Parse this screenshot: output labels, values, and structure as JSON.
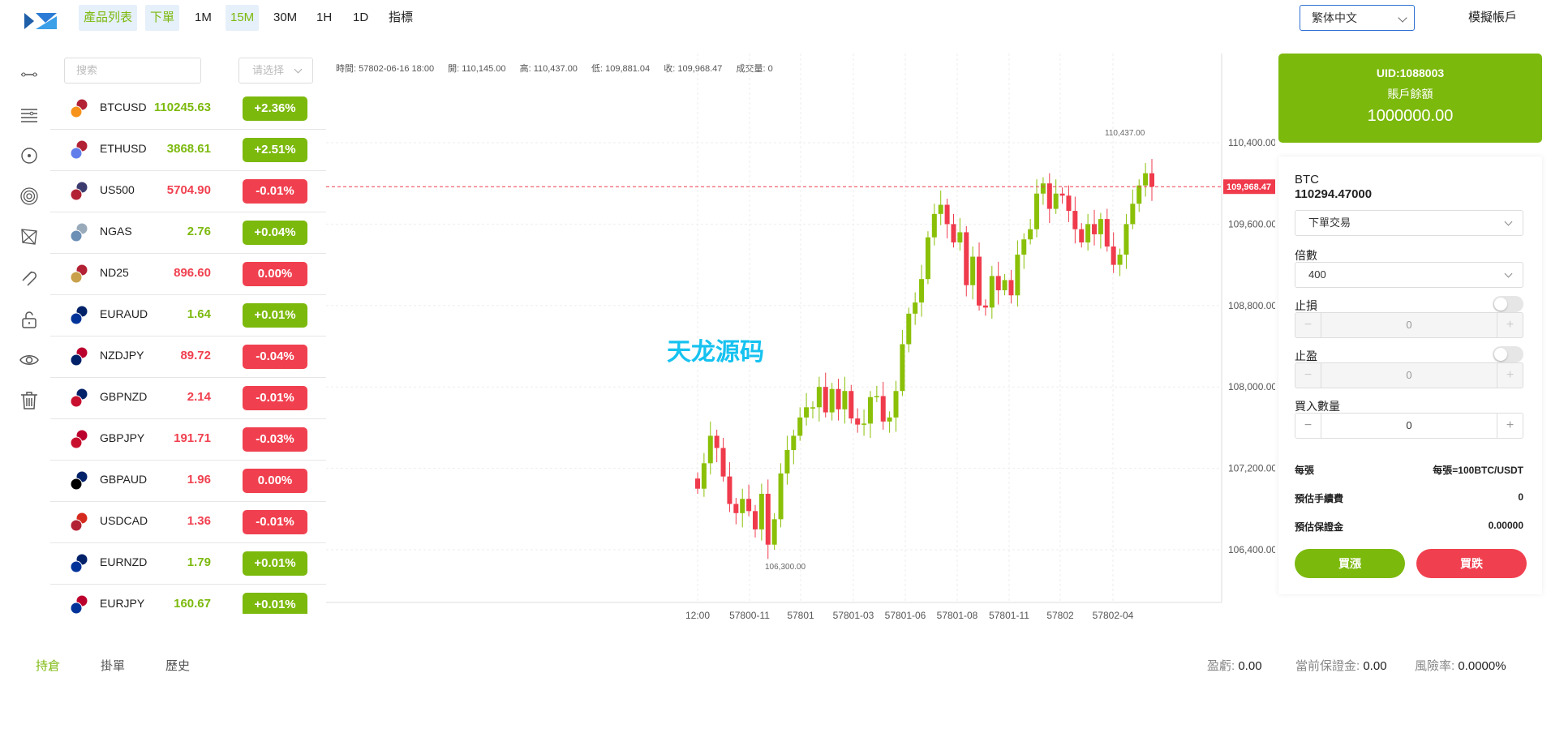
{
  "topbar": {
    "nav": [
      {
        "label": "產品列表",
        "active": true
      },
      {
        "label": "下單",
        "active": true
      },
      {
        "label": "1M",
        "active": false
      },
      {
        "label": "15M",
        "active": true
      },
      {
        "label": "30M",
        "active": false
      },
      {
        "label": "1H",
        "active": false
      },
      {
        "label": "1D",
        "active": false
      },
      {
        "label": "指標",
        "active": false
      }
    ],
    "language": "繁体中文",
    "demo_account": "模擬帳戶"
  },
  "toolbar_icons": [
    "trend-line-icon",
    "horizontal-lines-icon",
    "crosshair-icon",
    "target-icon",
    "pattern-icon",
    "magnet-icon",
    "lock-icon",
    "eye-icon",
    "trash-icon"
  ],
  "product_list": {
    "search_placeholder": "搜索",
    "filter_placeholder": "请选择",
    "items": [
      {
        "symbol": "BTCUSD",
        "price": "110245.63",
        "change": "+2.36%",
        "dir": "up",
        "flag": "btc-usd-flag-icon"
      },
      {
        "symbol": "ETHUSD",
        "price": "3868.61",
        "change": "+2.51%",
        "dir": "up",
        "flag": "eth-usd-flag-icon"
      },
      {
        "symbol": "US500",
        "price": "5704.90",
        "change": "-0.01%",
        "dir": "down",
        "flag": "us500-flag-icon"
      },
      {
        "symbol": "NGAS",
        "price": "2.76",
        "change": "+0.04%",
        "dir": "up",
        "flag": "ngas-logo-icon"
      },
      {
        "symbol": "ND25",
        "price": "896.60",
        "change": "0.00%",
        "dir": "down",
        "flag": "nd25-flag-icon"
      },
      {
        "symbol": "EURAUD",
        "price": "1.64",
        "change": "+0.01%",
        "dir": "up",
        "flag": "eur-aud-flag-icon"
      },
      {
        "symbol": "NZDJPY",
        "price": "89.72",
        "change": "-0.04%",
        "dir": "down",
        "flag": "nzd-jpy-flag-icon"
      },
      {
        "symbol": "GBPNZD",
        "price": "2.14",
        "change": "-0.01%",
        "dir": "down",
        "flag": "gbp-nzd-flag-icon"
      },
      {
        "symbol": "GBPJPY",
        "price": "191.71",
        "change": "-0.03%",
        "dir": "down",
        "flag": "gbp-jpy-flag-icon"
      },
      {
        "symbol": "GBPAUD",
        "price": "1.96",
        "change": "0.00%",
        "dir": "down",
        "flag": "gbp-aud-flag-icon"
      },
      {
        "symbol": "USDCAD",
        "price": "1.36",
        "change": "-0.01%",
        "dir": "down",
        "flag": "usd-cad-flag-icon"
      },
      {
        "symbol": "EURNZD",
        "price": "1.79",
        "change": "+0.01%",
        "dir": "up",
        "flag": "eur-nzd-flag-icon"
      },
      {
        "symbol": "EURJPY",
        "price": "160.67",
        "change": "+0.01%",
        "dir": "up",
        "flag": "eur-jpy-flag-icon"
      }
    ]
  },
  "chart_header": {
    "time": "時間: 57802-06-16 18:00",
    "open": "開: 110,145.00",
    "high": "高: 110,437.00",
    "low": "低: 109,881.04",
    "close": "收: 109,968.47",
    "volume": "成交量: 0"
  },
  "chart_data": {
    "type": "candlestick",
    "y_ticks": [
      "110,400.00",
      "109,600.00",
      "108,800.00",
      "108,000.00",
      "107,200.00",
      "106,400.00"
    ],
    "x_ticks": [
      "12:00",
      "57800-11",
      "57801",
      "57801-03",
      "57801-06",
      "57801-08",
      "57801-11",
      "57802",
      "57802-04"
    ],
    "current_price_label": "109,968.47",
    "high_marker": "110,437.00",
    "low_marker": "106,300.00",
    "watermark": "天龙源码",
    "colors": {
      "up": "#8ac007",
      "down": "#ef3b4c"
    }
  },
  "account": {
    "uid": "UID:1088003",
    "balance_label": "賬戶餘額",
    "balance": "1000000.00"
  },
  "order": {
    "symbol": "BTC",
    "price": "110294.47000",
    "order_type": "下單交易",
    "leverage_label": "倍數",
    "leverage": "400",
    "stop_loss_label": "止損",
    "stop_loss_value": "0",
    "take_profit_label": "止盈",
    "take_profit_value": "0",
    "qty_label": "買入數量",
    "qty_value": "0",
    "minus": "−",
    "plus": "+",
    "per_lot_label": "每張",
    "per_lot_value": "每張=100BTC/USDT",
    "fee_label": "預估手續費",
    "fee_value": "0",
    "margin_label": "預估保證金",
    "margin_value": "0.00000",
    "buy_label": "買漲",
    "sell_label": "買跌"
  },
  "bottom": {
    "tabs": [
      {
        "label": "持倉",
        "active": true
      },
      {
        "label": "掛單",
        "active": false
      },
      {
        "label": "歷史",
        "active": false
      }
    ],
    "pnl_label": "盈虧:",
    "pnl_value": "0.00",
    "margin_label": "當前保證金:",
    "margin_value": "0.00",
    "risk_label": "風險率:",
    "risk_value": "0.0000%"
  }
}
